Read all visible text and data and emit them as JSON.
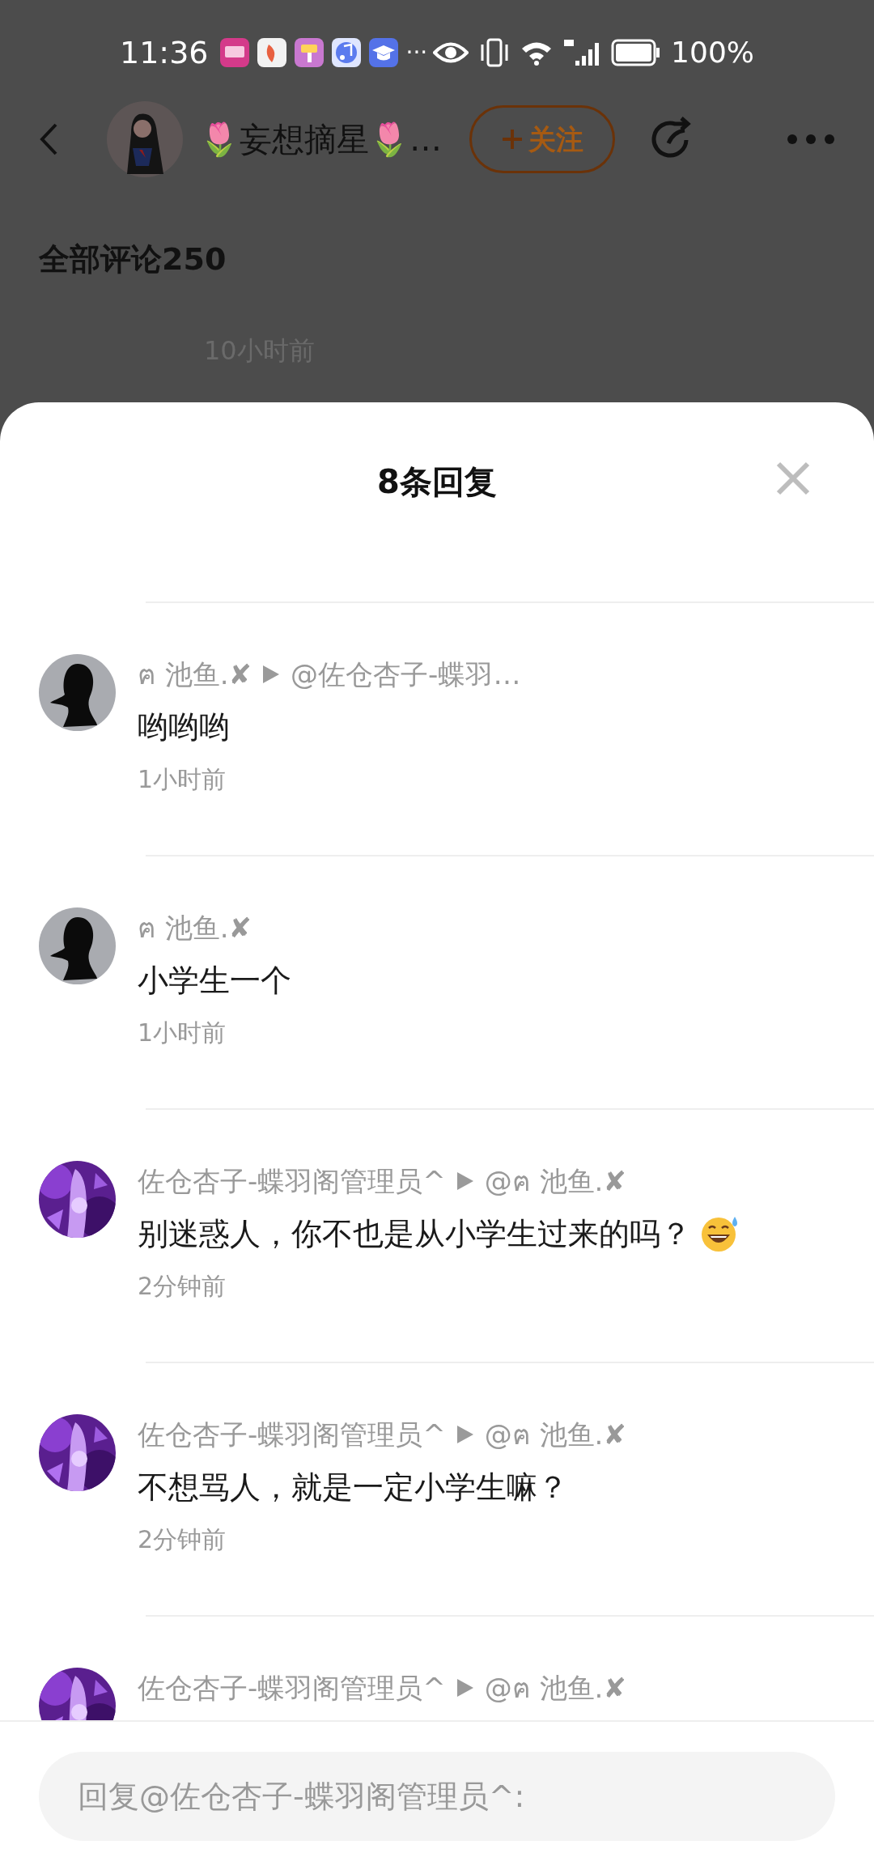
{
  "status_bar": {
    "time": "11:36",
    "more": "···",
    "battery": "100%"
  },
  "header": {
    "name": "🌷妄想摘星🌷…",
    "follow_button": "关注"
  },
  "section_title": "全部评论250",
  "background_time": "10小时前",
  "sheet": {
    "title": "8条回复",
    "replies": [
      {
        "avatar": {
          "kind": "silhouette"
        },
        "author": "ฅ 池鱼.✘",
        "reply_to": "@佐仓杏子-蝶羽…",
        "content": "哟哟哟",
        "time": "1小时前"
      },
      {
        "avatar": {
          "kind": "silhouette"
        },
        "author": "ฅ 池鱼.✘",
        "content": "小学生一个",
        "time": "1小时前"
      },
      {
        "author": "佐仓杏子-蝶羽阁管理员^",
        "reply_to": "@ฅ 池鱼.✘",
        "content": "别迷惑人，你不也是从小学生过来的吗？",
        "has_emoji": true,
        "time": "2分钟前"
      },
      {
        "author": "佐仓杏子-蝶羽阁管理员^",
        "reply_to": "@ฅ 池鱼.✘",
        "content": "不想骂人，就是一定小学生嘛？",
        "time": "2分钟前"
      },
      {
        "author": "佐仓杏子-蝶羽阁管理员^",
        "reply_to": "@ฅ 池鱼.✘"
      }
    ],
    "input": {
      "placeholder": "回复@佐仓杏子-蝶羽阁管理员^:"
    }
  }
}
